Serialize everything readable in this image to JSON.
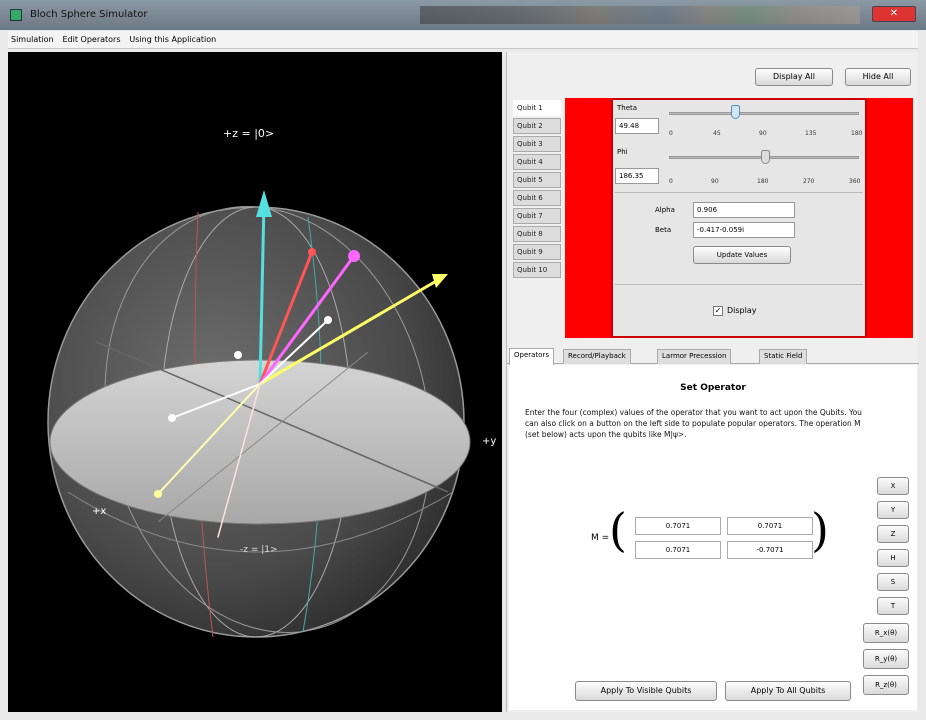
{
  "window": {
    "title": "Bloch Sphere Simulator",
    "close_label": "✕",
    "accent_close": "#dd3333"
  },
  "menu": [
    "Simulation",
    "Edit Operators",
    "Using this Application"
  ],
  "viewport": {
    "ket_zero": "+z = |0>",
    "ket_one": "-z = |1>",
    "axis_x": "+x",
    "axis_y": "+y",
    "vector_colors": [
      "#55e0e0",
      "#ff5555",
      "#ff66ff",
      "#ffff66",
      "#ffffff",
      "#ffe0e0"
    ]
  },
  "top_buttons": {
    "display_all": "Display All",
    "hide_all": "Hide All"
  },
  "qubits": [
    "Qubit 1",
    "Qubit 2",
    "Qubit 3",
    "Qubit 4",
    "Qubit 5",
    "Qubit 6",
    "Qubit 7",
    "Qubit 8",
    "Qubit 9",
    "Qubit 10"
  ],
  "qubit_panel": {
    "theta_label": "Theta",
    "theta_value": "49.48",
    "theta_ticks": [
      "0",
      "45",
      "90",
      "135",
      "180"
    ],
    "phi_label": "Phi",
    "phi_value": "186.35",
    "phi_ticks": [
      "0",
      "90",
      "180",
      "270",
      "360"
    ],
    "alpha_label": "Alpha",
    "alpha_value": "0.906",
    "beta_label": "Beta",
    "beta_value": "-0.417-0.059i",
    "update_label": "Update Values",
    "display_label": "Display",
    "display_checked": true
  },
  "tabs": [
    "Operators",
    "Record/Playback",
    "Larmor Precession",
    "Static Field"
  ],
  "operators": {
    "heading": "Set Operator",
    "description": "Enter the four (complex) values of the operator that you want to act upon the Qubits. You can also click on a button on the left side to populate popular operators. The operation M (set below) acts upon the qubits like M|ψ>.",
    "matrix_label": "M =",
    "matrix": [
      "0.7071",
      "0.7071",
      "0.7071",
      "-0.7071"
    ],
    "side_buttons": [
      "X",
      "Y",
      "Z",
      "H",
      "S",
      "T"
    ],
    "rotation_buttons": [
      "R_x(θ)",
      "R_y(θ)",
      "R_z(θ)"
    ],
    "apply_visible": "Apply To Visible Qubits",
    "apply_all": "Apply To All Qubits"
  }
}
